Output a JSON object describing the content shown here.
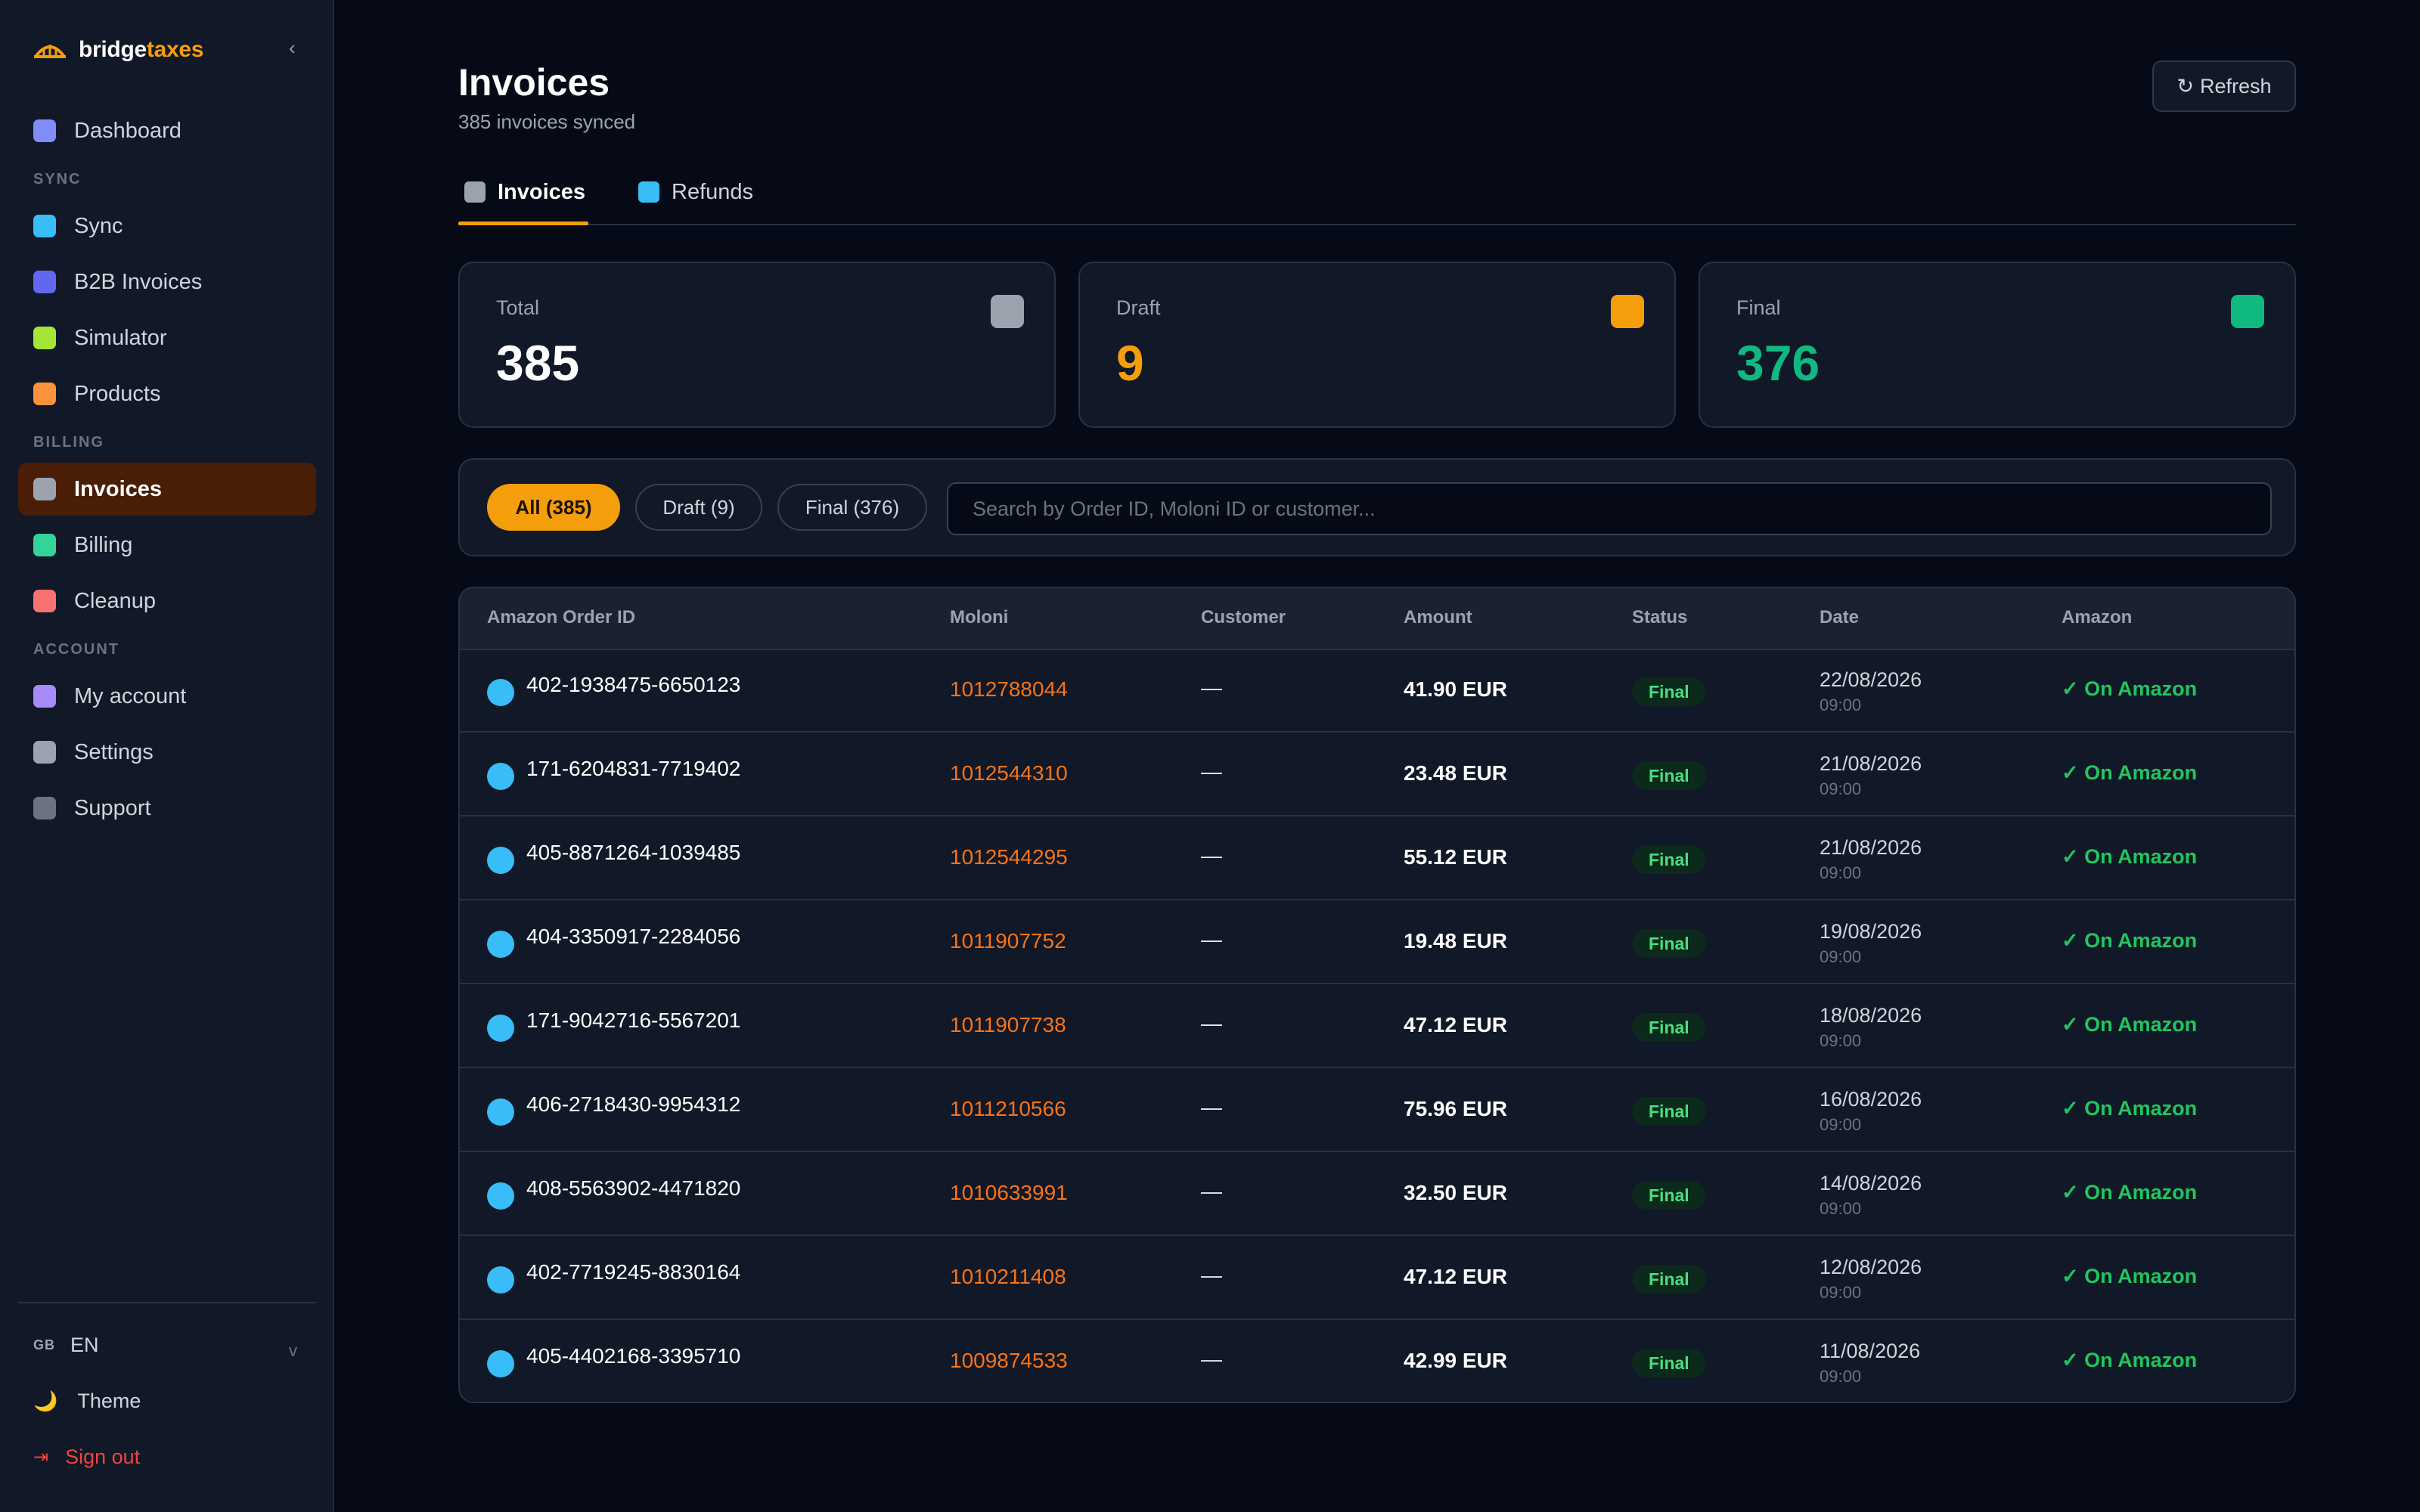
{
  "brand": {
    "part1": "bridge",
    "part2": "taxes",
    "collapse": "‹"
  },
  "sidebar": {
    "top_items": [
      {
        "label": "Dashboard",
        "color": "#818cf8"
      }
    ],
    "sections": [
      {
        "title": "SYNC",
        "items": [
          {
            "label": "Sync",
            "color": "#38bdf8"
          },
          {
            "label": "B2B Invoices",
            "color": "#6366f1"
          },
          {
            "label": "Simulator",
            "color": "#a3e635"
          },
          {
            "label": "Products",
            "color": "#fb923c"
          }
        ]
      },
      {
        "title": "BILLING",
        "items": [
          {
            "label": "Invoices",
            "color": "#9ca3af",
            "active": true
          },
          {
            "label": "Billing",
            "color": "#34d399"
          },
          {
            "label": "Cleanup",
            "color": "#f87171"
          }
        ]
      },
      {
        "title": "ACCOUNT",
        "items": [
          {
            "label": "My account",
            "color": "#a78bfa"
          },
          {
            "label": "Settings",
            "color": "#9ca3af"
          },
          {
            "label": "Support",
            "color": "#6b7280"
          }
        ]
      }
    ],
    "footer": {
      "flag": "GB",
      "language": "EN",
      "lang_chevron": "v",
      "theme_label": "Theme",
      "theme_icon": "🌙",
      "signout_label": "Sign out",
      "signout_icon": "⇥"
    }
  },
  "header": {
    "title": "Invoices",
    "subtitle": "385 invoices synced",
    "refresh_icon": "↻",
    "refresh_label": "Refresh"
  },
  "tabs": [
    {
      "label": "Invoices",
      "color": "#9ca3af",
      "active": true
    },
    {
      "label": "Refunds",
      "color": "#38bdf8",
      "active": false
    }
  ],
  "stats": [
    {
      "label": "Total",
      "value": "385",
      "value_color": "#ffffff",
      "icon_color": "#9ca3af"
    },
    {
      "label": "Draft",
      "value": "9",
      "value_color": "#f59e0b",
      "icon_color": "#f59e0b"
    },
    {
      "label": "Final",
      "value": "376",
      "value_color": "#10b981",
      "icon_color": "#10b981"
    }
  ],
  "filters": {
    "pills": [
      {
        "label": "All (385)",
        "active": true
      },
      {
        "label": "Draft (9)",
        "active": false
      },
      {
        "label": "Final (376)",
        "active": false
      }
    ],
    "search_placeholder": "Search by Order ID, Moloni ID or customer...",
    "search_value": ""
  },
  "table": {
    "columns": [
      "Amazon Order ID",
      "Moloni",
      "Customer",
      "Amount",
      "Status",
      "Date",
      "Amazon"
    ],
    "rows": [
      {
        "order": "402-1938475-6650123",
        "moloni": "1012788044",
        "customer": "—",
        "amount": "41.90 EUR",
        "status": "Final",
        "date": "22/08/2026",
        "time": "09:00",
        "amazon": "✓ On Amazon"
      },
      {
        "order": "171-6204831-7719402",
        "moloni": "1012544310",
        "customer": "—",
        "amount": "23.48 EUR",
        "status": "Final",
        "date": "21/08/2026",
        "time": "09:00",
        "amazon": "✓ On Amazon"
      },
      {
        "order": "405-8871264-1039485",
        "moloni": "1012544295",
        "customer": "—",
        "amount": "55.12 EUR",
        "status": "Final",
        "date": "21/08/2026",
        "time": "09:00",
        "amazon": "✓ On Amazon"
      },
      {
        "order": "404-3350917-2284056",
        "moloni": "1011907752",
        "customer": "—",
        "amount": "19.48 EUR",
        "status": "Final",
        "date": "19/08/2026",
        "time": "09:00",
        "amazon": "✓ On Amazon"
      },
      {
        "order": "171-9042716-5567201",
        "moloni": "1011907738",
        "customer": "—",
        "amount": "47.12 EUR",
        "status": "Final",
        "date": "18/08/2026",
        "time": "09:00",
        "amazon": "✓ On Amazon"
      },
      {
        "order": "406-2718430-9954312",
        "moloni": "1011210566",
        "customer": "—",
        "amount": "75.96 EUR",
        "status": "Final",
        "date": "16/08/2026",
        "time": "09:00",
        "amazon": "✓ On Amazon"
      },
      {
        "order": "408-5563902-4471820",
        "moloni": "1010633991",
        "customer": "—",
        "amount": "32.50 EUR",
        "status": "Final",
        "date": "14/08/2026",
        "time": "09:00",
        "amazon": "✓ On Amazon"
      },
      {
        "order": "402-7719245-8830164",
        "moloni": "1010211408",
        "customer": "—",
        "amount": "47.12 EUR",
        "status": "Final",
        "date": "12/08/2026",
        "time": "09:00",
        "amazon": "✓ On Amazon"
      },
      {
        "order": "405-4402168-3395710",
        "moloni": "1009874533",
        "customer": "—",
        "amount": "42.99 EUR",
        "status": "Final",
        "date": "11/08/2026",
        "time": "09:00",
        "amazon": "✓ On Amazon"
      }
    ]
  }
}
